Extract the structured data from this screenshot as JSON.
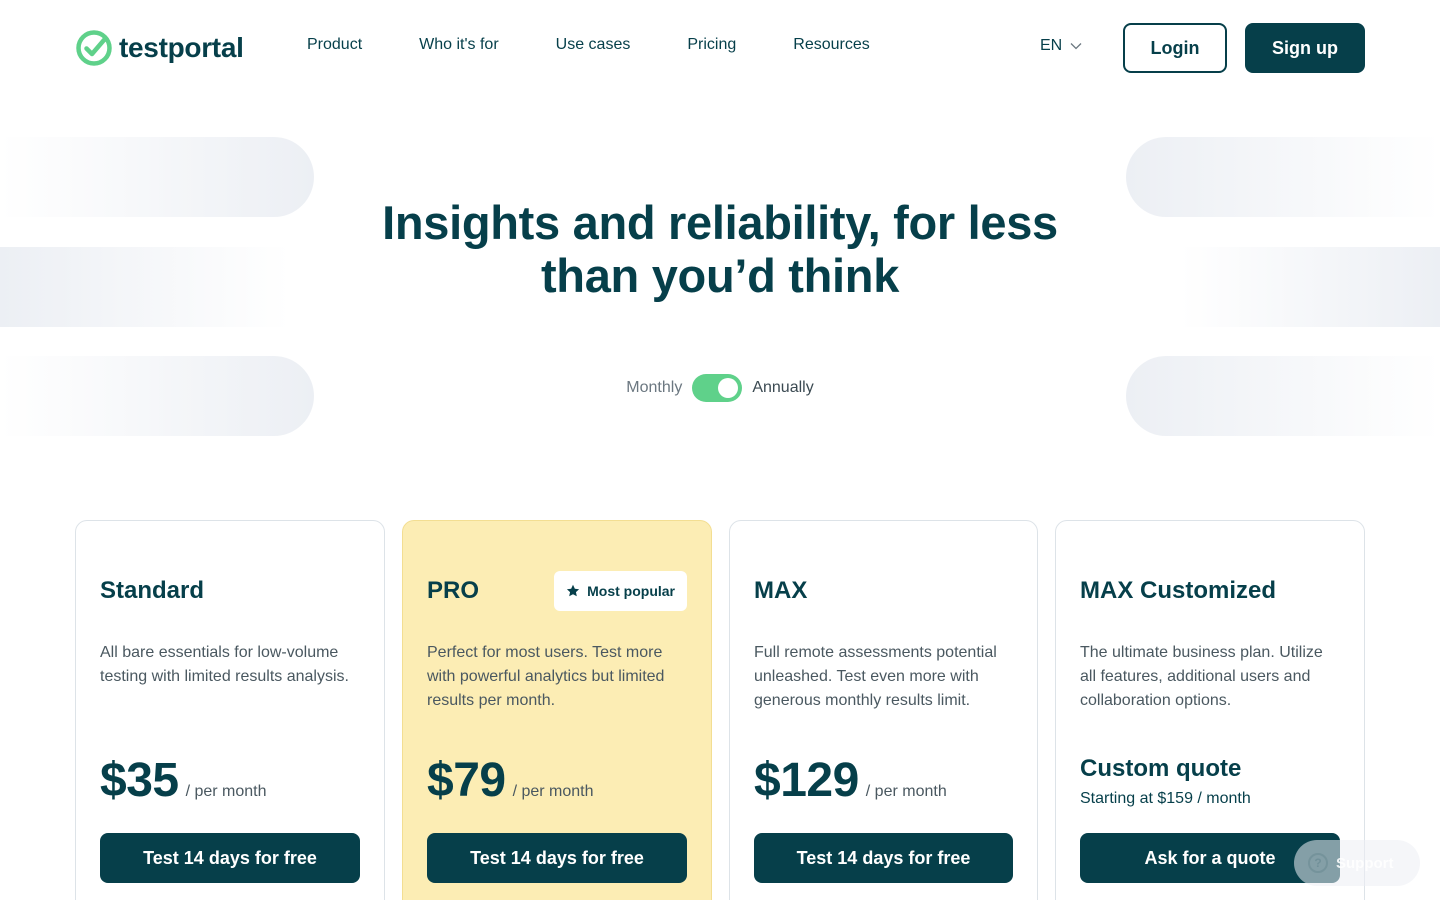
{
  "header": {
    "logo_text": "testportal",
    "nav": [
      "Product",
      "Who it's for",
      "Use cases",
      "Pricing",
      "Resources"
    ],
    "language": "EN",
    "login_label": "Login",
    "signup_label": "Sign up"
  },
  "hero": {
    "title_line1": "Insights and reliability, for less",
    "title_line2": "than you’d think"
  },
  "billing": {
    "monthly_label": "Monthly",
    "annually_label": "Annually",
    "selected": "Annually"
  },
  "plans": [
    {
      "name": "Standard",
      "description": "All bare essentials for low-volume testing with limited results analysis.",
      "price": "$35",
      "period": "/ per month",
      "cta": "Test 14 days for free"
    },
    {
      "name": "PRO",
      "badge": "Most popular",
      "description": "Perfect for most users. Test more with powerful analytics but limited results per month.",
      "price": "$79",
      "period": "/ per month",
      "cta": "Test 14 days for free"
    },
    {
      "name": "MAX",
      "description": "Full remote assessments potential unleashed. Test even more with generous monthly results limit.",
      "price": "$129",
      "period": "/ per month",
      "cta": "Test 14 days for free"
    },
    {
      "name": "MAX Customized",
      "description": "The ultimate business plan. Utilize all features, additional users and collaboration options.",
      "price_title": "Custom quote",
      "price_sub": "Starting at $159 / month",
      "cta": "Ask for a quote"
    }
  ],
  "support": {
    "label": "Support",
    "icon": "question-circle-icon"
  },
  "colors": {
    "brand_dark": "#063f4a",
    "brand_green": "#5fd18a",
    "pro_highlight": "#fcedb4"
  }
}
